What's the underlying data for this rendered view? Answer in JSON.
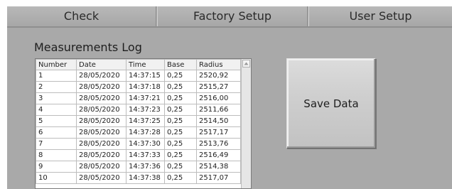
{
  "tabs": [
    {
      "label": "Check"
    },
    {
      "label": "Factory Setup"
    },
    {
      "label": "User Setup"
    }
  ],
  "log": {
    "title": "Measurements Log",
    "columns": [
      "Number",
      "Date",
      "Time",
      "Base",
      "Radius"
    ],
    "rows": [
      [
        "1",
        "28/05/2020",
        "14:37:15",
        "0,25",
        "2520,92"
      ],
      [
        "2",
        "28/05/2020",
        "14:37:18",
        "0,25",
        "2515,27"
      ],
      [
        "3",
        "28/05/2020",
        "14:37:21",
        "0,25",
        "2516,00"
      ],
      [
        "4",
        "28/05/2020",
        "14:37:23",
        "0,25",
        "2511,66"
      ],
      [
        "5",
        "28/05/2020",
        "14:37:25",
        "0,25",
        "2514,50"
      ],
      [
        "6",
        "28/05/2020",
        "14:37:28",
        "0,25",
        "2517,17"
      ],
      [
        "7",
        "28/05/2020",
        "14:37:30",
        "0,25",
        "2513,76"
      ],
      [
        "8",
        "28/05/2020",
        "14:37:33",
        "0,25",
        "2516,49"
      ],
      [
        "9",
        "28/05/2020",
        "14:37:36",
        "0,25",
        "2514,38"
      ],
      [
        "10",
        "28/05/2020",
        "14:37:38",
        "0,25",
        "2517,07"
      ]
    ]
  },
  "actions": {
    "save_label": "Save Data"
  },
  "icons": {
    "scroll_up": "triangle-up-icon"
  }
}
